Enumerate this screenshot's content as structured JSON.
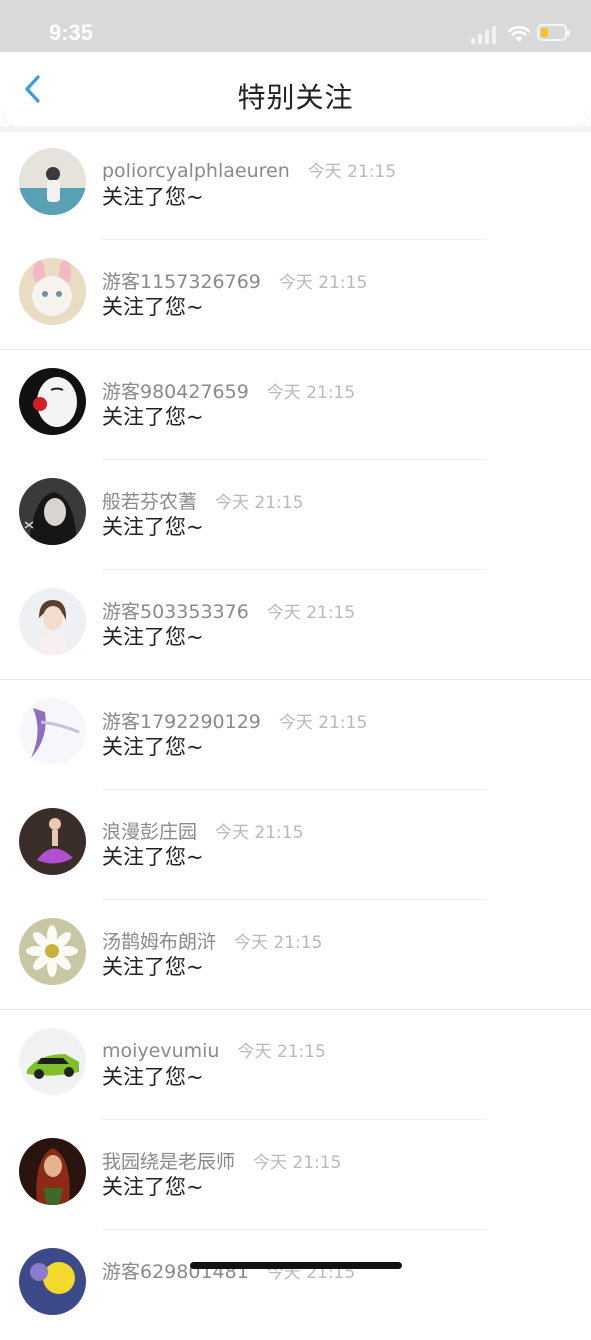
{
  "status": {
    "time": "9:35"
  },
  "nav": {
    "title": "特别关注",
    "back_icon": "chevron-left-icon",
    "accent": "#3a9ce6"
  },
  "items": [
    {
      "name": "poliorcyalphlaeuren",
      "time": "今天 21:15",
      "message": "关注了您~"
    },
    {
      "name": "游客1157326769",
      "time": "今天 21:15",
      "message": "关注了您~"
    },
    {
      "name": "游客980427659",
      "time": "今天 21:15",
      "message": "关注了您~"
    },
    {
      "name": "般若芬农蓍",
      "time": "今天 21:15",
      "message": "关注了您~"
    },
    {
      "name": "游客503353376",
      "time": "今天 21:15",
      "message": "关注了您~"
    },
    {
      "name": "游客1792290129",
      "time": "今天 21:15",
      "message": "关注了您~"
    },
    {
      "name": "浪漫彭庄园",
      "time": "今天 21:15",
      "message": "关注了您~"
    },
    {
      "name": "汤鹊姆布朗浒",
      "time": "今天 21:15",
      "message": "关注了您~"
    },
    {
      "name": "moiyevumiu",
      "time": "今天 21:15",
      "message": "关注了您~"
    },
    {
      "name": "我园绕是老辰师",
      "time": "今天 21:15",
      "message": "关注了您~"
    },
    {
      "name": "游客629801481",
      "time": "今天 21:15",
      "message": ""
    }
  ]
}
